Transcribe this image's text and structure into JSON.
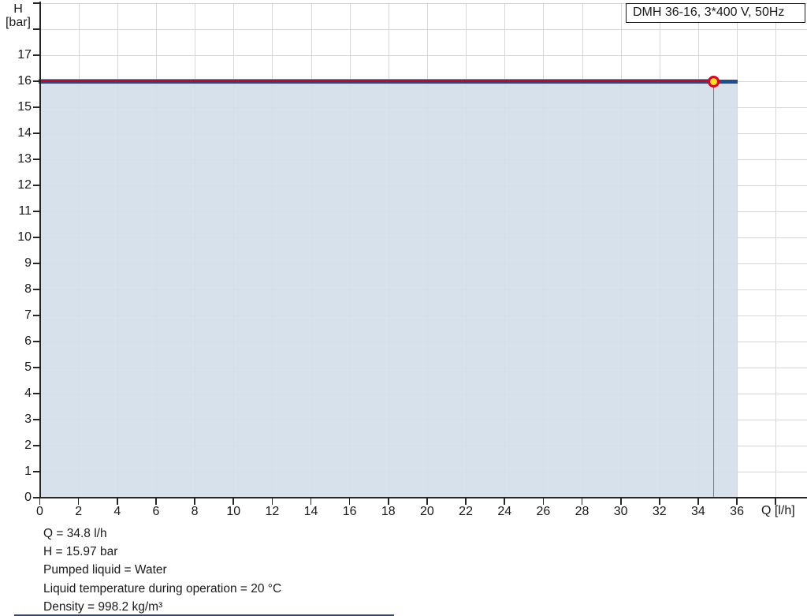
{
  "legend": {
    "label": "DMH 36-16, 3*400 V, 50Hz"
  },
  "chart_data": {
    "type": "area",
    "title": "DMH 36-16, 3*400 V, 50Hz",
    "x_axis": {
      "label": "Q [l/h]",
      "min": 0,
      "max": 38,
      "tick_step": 2,
      "last_labeled_tick": 36
    },
    "y_axis": {
      "label_line1": "H",
      "label_line2": "[bar]",
      "min": 0,
      "max": 19,
      "tick_step": 1,
      "last_labeled_tick": 17
    },
    "series": [
      {
        "name": "pump-qh-curve",
        "color": "#1e4c8f",
        "points": [
          [
            0,
            15.97
          ],
          [
            36,
            15.97
          ]
        ]
      },
      {
        "name": "selected-duty-range",
        "color": "#d2001e",
        "points": [
          [
            0,
            15.97
          ],
          [
            34.8,
            15.97
          ]
        ]
      }
    ],
    "curve_top_edge_color": "#8196ad",
    "area_fill": {
      "q_from": 0,
      "q_to": 36,
      "color": "#d3dee9"
    },
    "operating_point": {
      "q": 34.8,
      "h": 15.97,
      "fill_color": "#ffe11e",
      "ring_color": "#e3001f"
    },
    "duty_line_color": "#6e7f95",
    "grid_color": "#d6d6d6",
    "axis_color": "#262626",
    "grid_on": true,
    "legend_position": "top-right"
  },
  "info": {
    "lines": [
      "Q = 34.8 l/h",
      "H = 15.97 bar",
      "Pumped liquid = Water",
      "Liquid temperature during operation = 20 °C",
      "Density = 998.2 kg/m³"
    ]
  },
  "divider_color": "#2b4a7d"
}
